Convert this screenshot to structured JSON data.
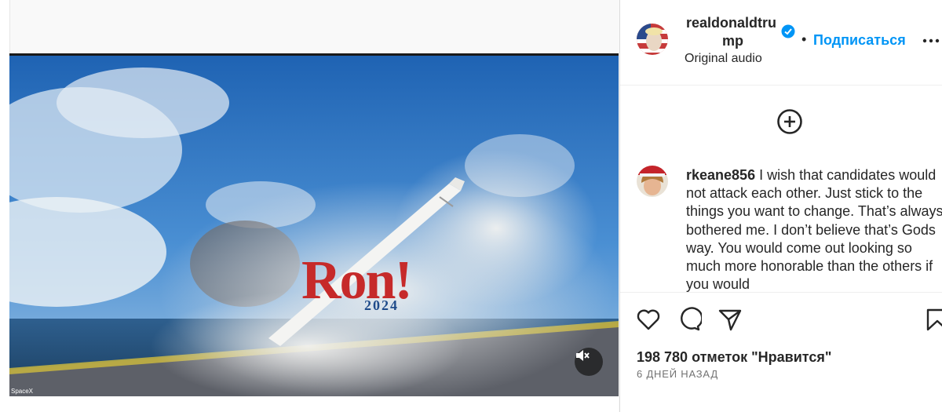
{
  "post": {
    "username_line1": "realdonaldtru",
    "username_line2": "mp",
    "follow_label": "Подписаться",
    "separator": "•",
    "audio_label": "Original audio",
    "verified_color": "#0095f6"
  },
  "video": {
    "logo_text": "Ron!",
    "logo_year": "2024",
    "source_watermark": "SpaceX",
    "mute_icon": "speaker-muted-icon"
  },
  "comment": {
    "author": "rkeane856",
    "text": "I wish that candidates would not attack each other. Just stick to the things you want to change. That’s always bothered me. I don’t believe that’s Gods way. You would come out looking so much more honorable than the others if you would"
  },
  "actions": {
    "icons": [
      "heart-icon",
      "comment-icon",
      "share-icon",
      "bookmark-icon"
    ]
  },
  "stats": {
    "likes": "198 780 отметок \"Нравится\"",
    "time_ago": "6 ДНЕЙ НАЗАД"
  },
  "colors": {
    "accent": "#0095f6",
    "logo_red": "#c62a2a",
    "logo_blue": "#1f4b8a"
  }
}
